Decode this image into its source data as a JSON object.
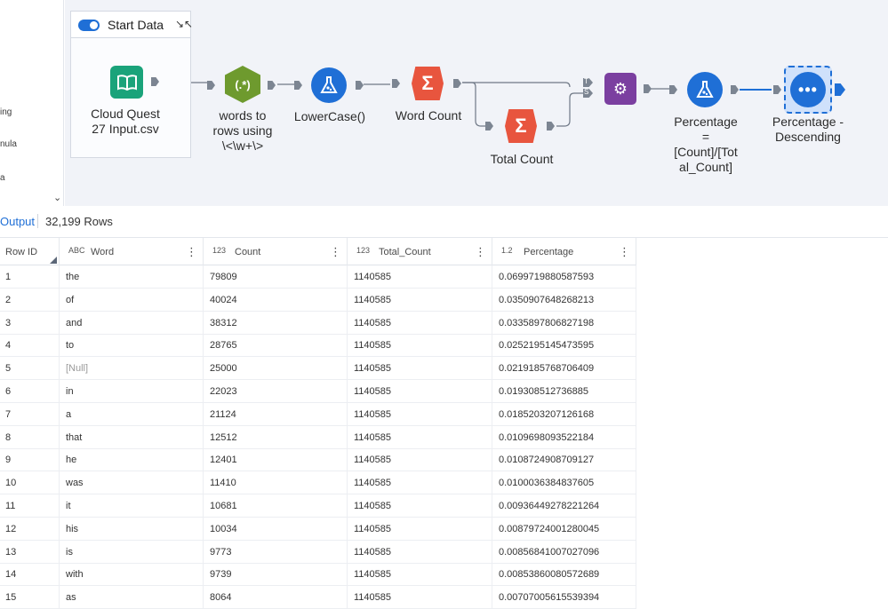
{
  "palette": {
    "items": [
      "ing",
      "nula",
      "a"
    ],
    "scroll_icon": "chevron-down-icon"
  },
  "container": {
    "title": "Start Data",
    "toggle_on": true
  },
  "workflow": {
    "tools": {
      "input": {
        "label": "Cloud Quest 27 Input.csv",
        "label_lines": [
          "Cloud Quest",
          "27 Input.csv"
        ],
        "icon": "book-icon",
        "color": "#1aa37a"
      },
      "regex": {
        "label_lines": [
          "words to",
          "rows using",
          "\\<\\w+\\>"
        ],
        "icon_text": "(.*)",
        "icon": "regex-icon",
        "color": "#6e9a2e"
      },
      "lowercase": {
        "label": "LowerCase()",
        "icon": "formula-flask-icon",
        "color": "#1f6fd6"
      },
      "wordcount": {
        "label": "Word Count",
        "icon": "summarize-icon",
        "color": "#e8553e"
      },
      "totalcount": {
        "label": "Total Count",
        "icon": "summarize-icon",
        "color": "#e8553e"
      },
      "join": {
        "icon": "append-fields-icon",
        "color": "#7b3fa0",
        "anchor_t": "T",
        "anchor_s": "S"
      },
      "percentage": {
        "label_lines": [
          "Percentage",
          "=",
          "[Count]/[Tot",
          "al_Count]"
        ],
        "icon": "formula-flask-icon",
        "color": "#1f6fd6"
      },
      "sort": {
        "label_lines": [
          "Percentage -",
          "Descending"
        ],
        "icon": "sort-icon",
        "color": "#1f6fd6"
      }
    }
  },
  "output": {
    "label": "Output",
    "rows": "32,199 Rows"
  },
  "grid": {
    "columns": [
      {
        "name": "Row ID",
        "type": ""
      },
      {
        "name": "Word",
        "type": "ABC"
      },
      {
        "name": "Count",
        "type": "123"
      },
      {
        "name": "Total_Count",
        "type": "123"
      },
      {
        "name": "Percentage",
        "type": "1.2"
      }
    ],
    "rows": [
      [
        "1",
        "the",
        "79809",
        "1140585",
        "0.0699719880587593"
      ],
      [
        "2",
        "of",
        "40024",
        "1140585",
        "0.0350907648268213"
      ],
      [
        "3",
        "and",
        "38312",
        "1140585",
        "0.0335897806827198"
      ],
      [
        "4",
        "to",
        "28765",
        "1140585",
        "0.0252195145473595"
      ],
      [
        "5",
        "[Null]",
        "25000",
        "1140585",
        "0.0219185768706409"
      ],
      [
        "6",
        "in",
        "22023",
        "1140585",
        "0.019308512736885"
      ],
      [
        "7",
        "a",
        "21124",
        "1140585",
        "0.0185203207126168"
      ],
      [
        "8",
        "that",
        "12512",
        "1140585",
        "0.0109698093522184"
      ],
      [
        "9",
        "he",
        "12401",
        "1140585",
        "0.0108724908709127"
      ],
      [
        "10",
        "was",
        "11410",
        "1140585",
        "0.0100036384837605"
      ],
      [
        "11",
        "it",
        "10681",
        "1140585",
        "0.00936449278221264"
      ],
      [
        "12",
        "his",
        "10034",
        "1140585",
        "0.00879724001280045"
      ],
      [
        "13",
        "is",
        "9773",
        "1140585",
        "0.00856841007027096"
      ],
      [
        "14",
        "with",
        "9739",
        "1140585",
        "0.00853860080572689"
      ],
      [
        "15",
        "as",
        "8064",
        "1140585",
        "0.00707005615539394"
      ]
    ]
  }
}
